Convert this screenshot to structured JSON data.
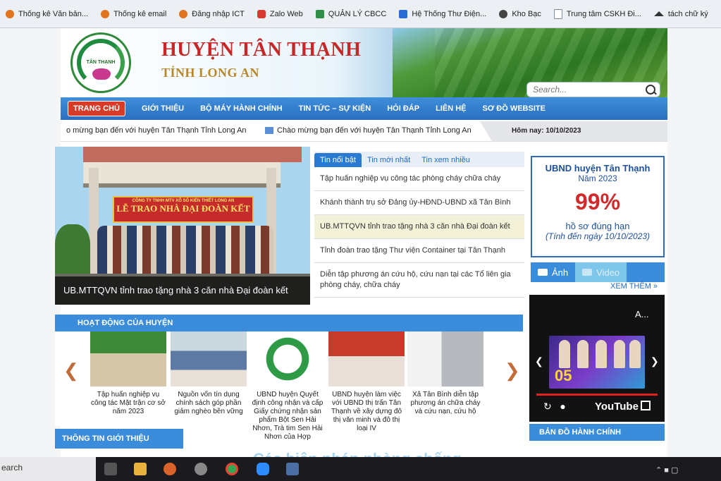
{
  "bookmarks": [
    {
      "label": "Thống kê Văn bản...",
      "icon": "orange-circle-icon"
    },
    {
      "label": "Thống kê email",
      "icon": "orange-circle-icon"
    },
    {
      "label": "Đăng nhập ICT",
      "icon": "orange-circle-icon"
    },
    {
      "label": "Zalo Web",
      "icon": "zalo-icon"
    },
    {
      "label": "QUẢN LÝ CBCC",
      "icon": "ict-icon"
    },
    {
      "label": "Hệ Thống Thư Điện...",
      "icon": "outlook-icon"
    },
    {
      "label": "Kho Bạc",
      "icon": "globe-icon"
    },
    {
      "label": "Trung tâm CSKH Đi...",
      "icon": "page-icon"
    },
    {
      "label": "tách chữ ký",
      "icon": "hat-icon"
    }
  ],
  "header": {
    "logo_text": "TÂN THẠNH",
    "title": "HUYỆN TÂN THẠNH",
    "subtitle": "TỈNH LONG AN",
    "search_placeholder": "Search..."
  },
  "nav": [
    "TRANG CHỦ",
    "GIỚI THIỆU",
    "BỘ MÁY HÀNH CHÍNH",
    "TIN TỨC – SỰ KIỆN",
    "HỎI ĐÁP",
    "LIÊN HỆ",
    "SƠ ĐỒ WEBSITE"
  ],
  "ticker": {
    "text1": "o mừng bạn đến với huyện Tân Thạnh Tỉnh Long An",
    "text2": "Chào mừng bạn đến với huyện Tân Thạnh Tỉnh Long An",
    "today": "Hôm nay: 10/10/2023"
  },
  "featured": {
    "sign_small": "CÔNG TY TNHH MTV XỔ SỐ KIẾN THIẾT LONG AN",
    "sign_big": "LỄ TRAO NHÀ ĐẠI ĐOÀN KẾT",
    "caption": "UB.MTTQVN tỉnh trao tặng nhà 3 căn nhà Đại đoàn kết"
  },
  "news": {
    "tabs": [
      "Tin nổi bật",
      "Tin mới nhất",
      "Tin xem nhiều"
    ],
    "items": [
      "Tập huấn nghiệp vụ công tác phòng cháy chữa cháy",
      "Khánh thành trụ sở Đảng ủy-HĐND-UBND xã Tân Bình",
      "UB.MTTQVN tỉnh trao tặng nhà 3 căn nhà Đại đoàn kết",
      "Tỉnh đoàn trao tặng Thư viện Container tại Tân Thạnh",
      "Diễn tập phương án cứu hộ, cứu nạn tại các Tổ liên gia phòng cháy, chữa cháy"
    ]
  },
  "stats": {
    "title": "UBND huyện Tân Thạnh",
    "year": "Năm 2023",
    "percent": "99%",
    "desc": "hồ sơ đúng hạn",
    "note": "(Tính đến ngày 10/10/2023)"
  },
  "media": {
    "tab_photo": "Ảnh",
    "tab_video": "Video",
    "more": "XEM THÊM »",
    "video_title": "A...",
    "video_num": "05",
    "youtube": "YouTube"
  },
  "activities": {
    "heading": "HOẠT ĐỘNG CỦA HUYỆN",
    "items": [
      "Tập huấn nghiệp vụ công tác Mặt trận cơ sở năm 2023",
      "Nguồn vốn tín dụng chính sách góp phần giảm nghèo bền vững",
      "UBND huyện Quyết định công nhận và cấp Giấy chứng nhận sản phẩm Bột Sen Hải Nhơn, Trà tim Sen Hải Nhơn của Hợp",
      "UBND huyện làm việc với UBND thị trấn Tân Thạnh về xây dựng đô thị văn minh và đô thị loại IV",
      "Xã Tân Bình diễn tập phương án chữa cháy và cứu nạn, cứu hộ"
    ]
  },
  "map_heading": "BẢN ĐỒ HÀNH CHÍNH",
  "info_heading": "THÔNG TIN GIỚI THIỆU",
  "bottom_text": "Các biện pháp phòng chống",
  "taskbar": {
    "search": "earch"
  }
}
